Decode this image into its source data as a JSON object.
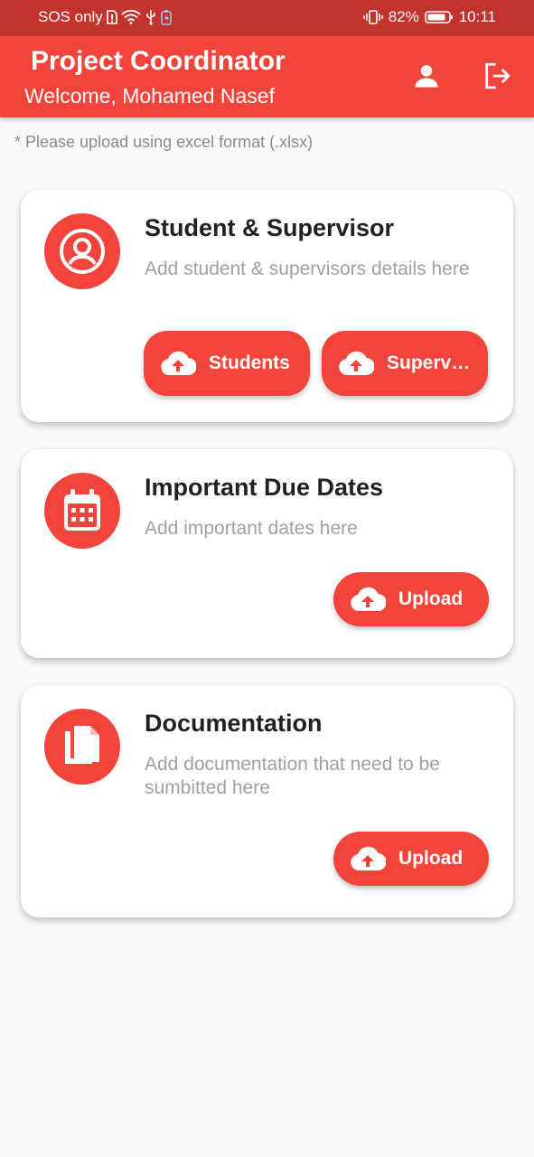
{
  "status_bar": {
    "carrier": "SOS only",
    "battery": "82%",
    "time": "10:11"
  },
  "app_bar": {
    "title": "Project Coordinator",
    "subtitle": "Welcome, Mohamed Nasef"
  },
  "hint": "* Please upload using excel format (.xlsx)",
  "cards": [
    {
      "title": "Student & Supervisor",
      "description": "Add student & supervisors details here",
      "icon": "account-circle-icon",
      "buttons": [
        {
          "label": "Students",
          "icon": "cloud-upload-icon"
        },
        {
          "label": "Supervisors",
          "icon": "cloud-upload-icon"
        }
      ]
    },
    {
      "title": "Important Due Dates",
      "description": "Add important dates here",
      "icon": "calendar-icon",
      "buttons": [
        {
          "label": "Upload",
          "icon": "cloud-upload-icon"
        }
      ]
    },
    {
      "title": "Documentation",
      "description": "Add documentation that need to be sumbitted here",
      "icon": "documents-icon",
      "buttons": [
        {
          "label": "Upload",
          "icon": "cloud-upload-icon"
        }
      ]
    }
  ],
  "colors": {
    "primary": "#f3443b",
    "status_bar": "#c1332c",
    "background": "#fafafa",
    "muted_text": "#a0a0a0"
  }
}
